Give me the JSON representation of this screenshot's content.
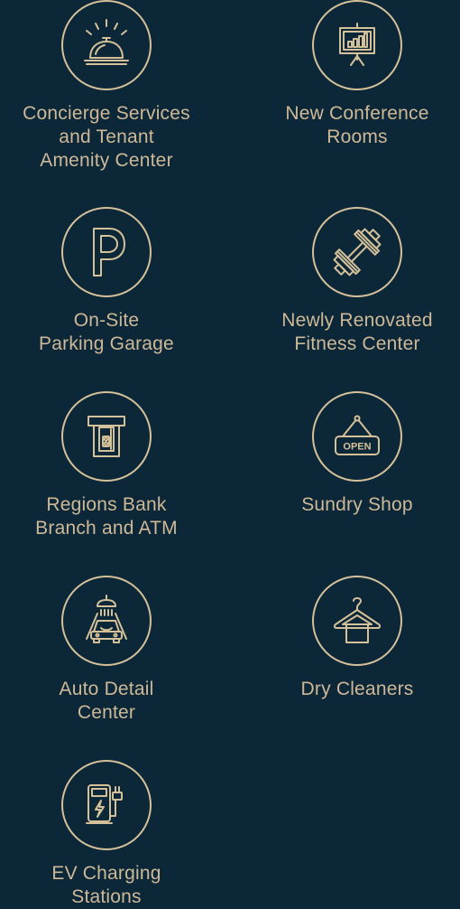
{
  "colors": {
    "background": "#0c2738",
    "accent": "#d4c19a",
    "text": "#cdb998"
  },
  "amenities": [
    {
      "icon": "concierge-bell-icon",
      "lines": [
        "Concierge Services",
        "and Tenant",
        "Amenity Center"
      ]
    },
    {
      "icon": "presentation-board-icon",
      "lines": [
        "New Conference",
        "Rooms"
      ]
    },
    {
      "icon": "parking-icon",
      "lines": [
        "On-Site",
        "Parking Garage"
      ]
    },
    {
      "icon": "dumbbell-icon",
      "lines": [
        "Newly Renovated",
        "Fitness Center"
      ]
    },
    {
      "icon": "atm-icon",
      "lines": [
        "Regions Bank",
        "Branch and ATM"
      ]
    },
    {
      "icon": "open-sign-icon",
      "lines": [
        "Sundry Shop"
      ],
      "sign_text": "OPEN"
    },
    {
      "icon": "car-wash-icon",
      "lines": [
        "Auto Detail",
        "Center"
      ]
    },
    {
      "icon": "clothes-hanger-icon",
      "lines": [
        "Dry Cleaners"
      ]
    },
    {
      "icon": "ev-charger-icon",
      "lines": [
        "EV Charging",
        "Stations"
      ]
    }
  ]
}
